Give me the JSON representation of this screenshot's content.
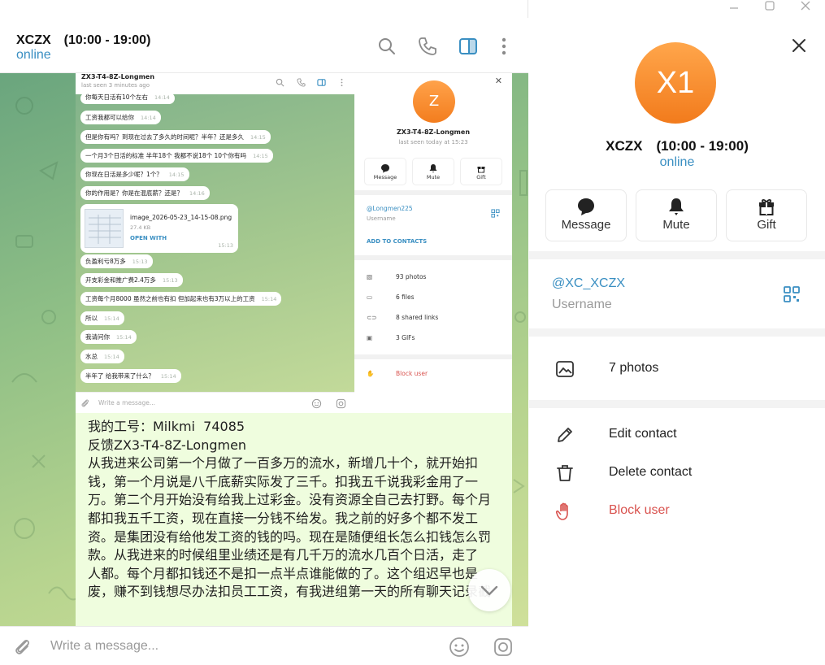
{
  "header": {
    "title": "XCZX　(10:00 - 19:00)",
    "status": "online"
  },
  "screenshot": {
    "chat_title": "ZX3-T4-8Z-Longmen",
    "last_seen": "last seen 3 minutes ago",
    "messages": [
      {
        "text": "你每天日活有10个左右",
        "time": "14:14"
      },
      {
        "text": "工资我都可以给你",
        "time": "14:14"
      },
      {
        "text": "但是你有吗？到现在过去了多久的时间呢？半年？还是多久",
        "time": "14:15"
      },
      {
        "text": "一个月3个日活的标准 半年18个 我都不说18个 10个你有吗",
        "time": "14:15"
      },
      {
        "text": "你现在日活是多少呢？1个？",
        "time": "14:15"
      },
      {
        "text": "你的作用是？你是在混底薪？还是？",
        "time": "14:16"
      },
      {
        "text": "负盈利亏8万多",
        "time": "15:13"
      },
      {
        "text": "开支彩金和推广费2.4万多",
        "time": "15:13"
      },
      {
        "text": "工资每个月8000 虽然之前也有扣 但加起来也有3万以上的工资",
        "time": "15:14"
      },
      {
        "text": "所以",
        "time": "15:14"
      },
      {
        "text": "我请问你",
        "time": "15:14"
      },
      {
        "text": "水总",
        "time": "15:14"
      },
      {
        "text": "半年了 给我带来了什么？",
        "time": "15:14"
      }
    ],
    "file": {
      "name": "image_2026-05-23_14-15-08.png",
      "size": "27.4 KB",
      "action": "OPEN WITH",
      "time": "15:13"
    },
    "input_placeholder": "Write a message...",
    "panel": {
      "avatar_letter": "Z",
      "name": "ZX3-T4-8Z-Longmen",
      "last_seen": "last seen today at 15:23",
      "buttons": [
        "Message",
        "Mute",
        "Gift"
      ],
      "username": "@Longmen225",
      "username_label": "Username",
      "add_contact": "ADD TO CONTACTS",
      "media": [
        "93 photos",
        "6 files",
        "8 shared links",
        "3 GIFs"
      ],
      "block": "Block user"
    }
  },
  "message": {
    "lines": [
      "我的工号：Milkmi  74085",
      "",
      "",
      "反馈ZX3-T4-8Z-Longmen",
      "从我进来公司第一个月做了一百多万的流水，新增几十个，就开始扣",
      "钱，第一个月说是八千底薪实际发了三千。扣我五千说我彩金用了一",
      "万。第二个月开始没有给我上过彩金。没有资源全自己去打野。每个月",
      "都扣我五千工资，现在直接一分钱不给发。我之前的好多个都不发工",
      "资。是集团没有给他发工资的钱的吗。现在是随便组长怎么扣钱怎么罚",
      "款。从我进来的时候组里业绩还是有几千万的流水几百个日活，走了",
      "人都。每个月都扣钱还不是扣一点半点谁能做的了。这个组迟早也是",
      "废，赚不到钱想尽办法扣员工工资，有我进组第一天的所有聊天记录截"
    ]
  },
  "composer": {
    "placeholder": "Write a message..."
  },
  "profile": {
    "avatar_text": "X1",
    "name": "XCZX　(10:00 - 19:00)",
    "status": "online",
    "buttons": {
      "message": "Message",
      "mute": "Mute",
      "gift": "Gift"
    },
    "username": "@XC_XCZX",
    "username_label": "Username",
    "photos": "7 photos",
    "edit": "Edit contact",
    "delete": "Delete contact",
    "block": "Block user"
  },
  "colors": {
    "accent": "#3a8fc2",
    "avatar_orange": "#f37d1e",
    "danger": "#d9534f",
    "bubble": "#effdde"
  }
}
